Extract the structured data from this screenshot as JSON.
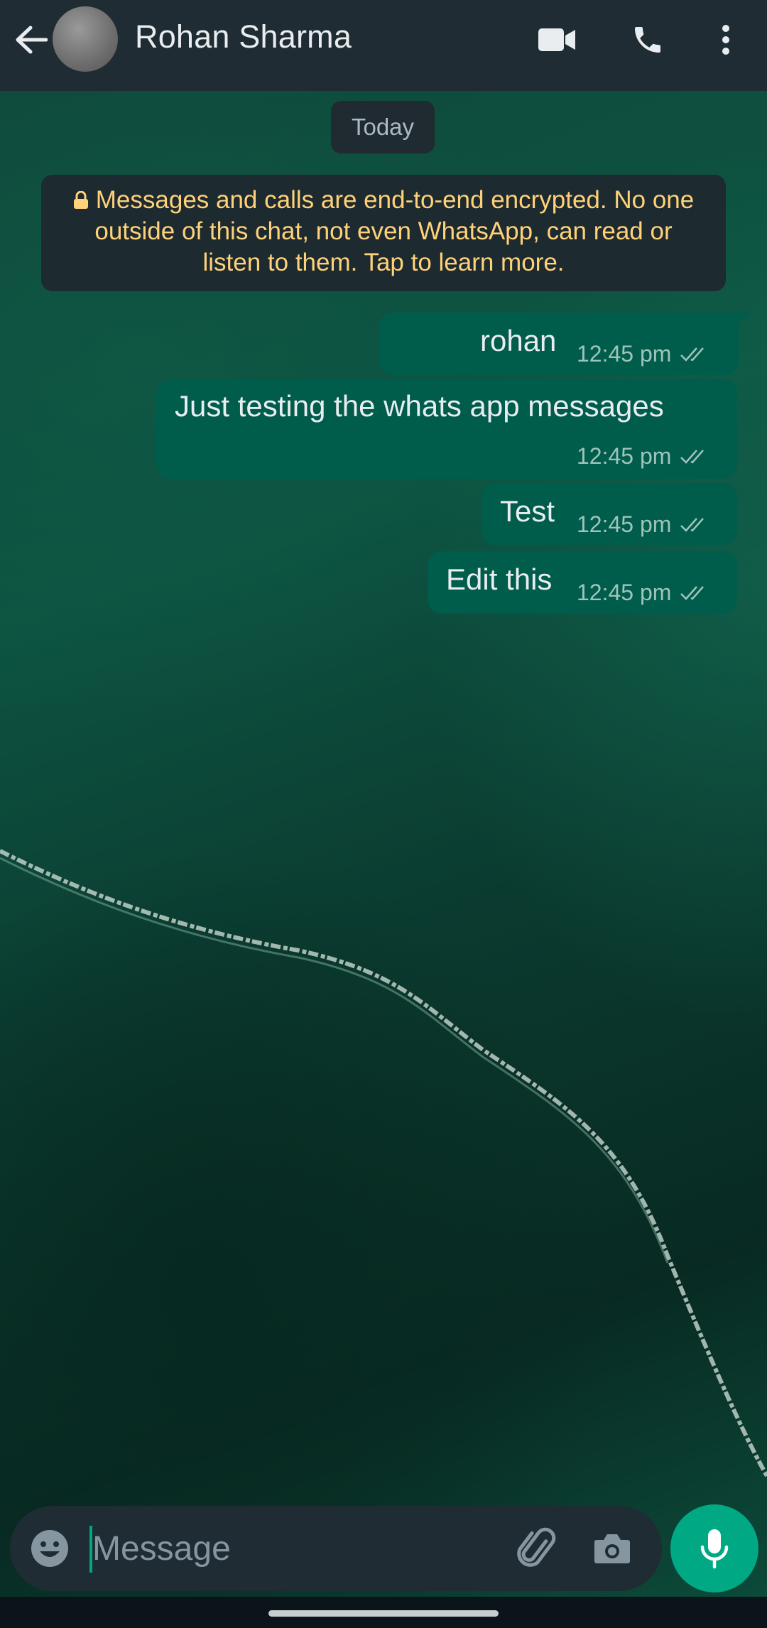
{
  "header": {
    "contact_name": "Rohan Sharma",
    "icons": [
      "back-arrow-icon",
      "avatar",
      "video-call-icon",
      "phone-icon",
      "more-options-icon"
    ]
  },
  "chat": {
    "date_label": "Today",
    "encryption_notice": "Messages and calls are end-to-end encrypted. No one outside of this chat, not even WhatsApp, can read or listen to them. Tap to learn more.",
    "messages": [
      {
        "text": "rohan",
        "time": "12:45 pm",
        "status": "read-ticks"
      },
      {
        "text": "Just testing the whats app messages",
        "time": "12:45 pm",
        "status": "read-ticks"
      },
      {
        "text": "Test",
        "time": "12:45 pm",
        "status": "read-ticks"
      },
      {
        "text": "Edit this",
        "time": "12:45 pm",
        "status": "read-ticks"
      }
    ]
  },
  "composer": {
    "placeholder": "Message",
    "value": "",
    "icons": [
      "emoji-icon",
      "attach-icon",
      "camera-icon",
      "mic-icon"
    ]
  },
  "colors": {
    "header_bg": "#202c33",
    "outgoing_bubble": "#005c4b",
    "notice_text": "#ffd279",
    "accent": "#00a884"
  }
}
